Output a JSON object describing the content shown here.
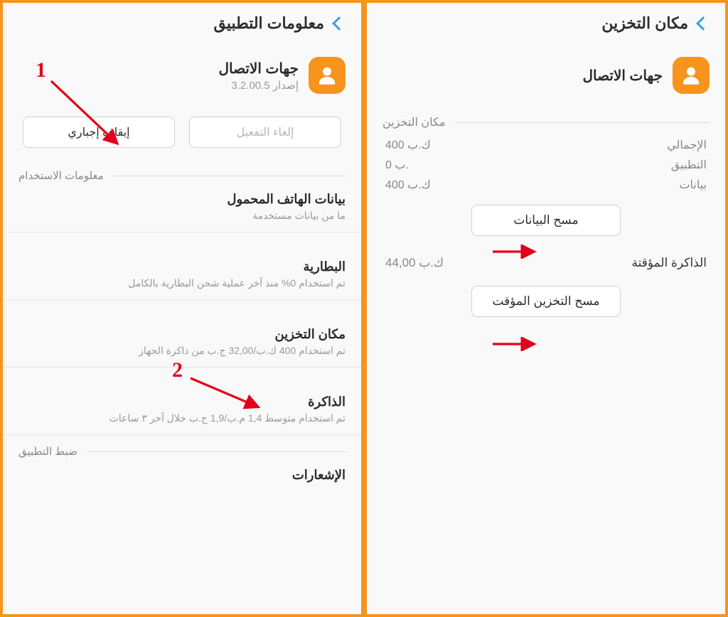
{
  "left": {
    "header_title": "معلومات التطبيق",
    "app_name": "جهات الاتصال",
    "app_version": "إصدار 3.2.00.5",
    "btn_disable": "إلغاء التفعيل",
    "btn_force_stop": "إيقاف إجباري",
    "section_usage": "معلومات الاستخدام",
    "items": {
      "mobile_data": {
        "title": "بيانات الهاتف المحمول",
        "sub": "ما من بيانات مستخدمة"
      },
      "battery": {
        "title": "البطارية",
        "sub": "تم استخدام 0% منذ آخر عملية شحن البطارية بالكامل"
      },
      "storage": {
        "title": "مكان التخزين",
        "sub": "تم استخدام 400 ك.ب/32,00 ج.ب من ذاكرة الجهاز"
      },
      "memory": {
        "title": "الذاكرة",
        "sub": "تم استخدام متوسط 1,4 م.ب/1,9 ج.ب خلال آخر ٣ ساعات"
      }
    },
    "section_appsettings": "ضبط التطبيق",
    "notifications_title": "الإشعارات",
    "callouts": {
      "num1": "1",
      "num2": "2"
    }
  },
  "right": {
    "header_title": "مكان التخزين",
    "app_name": "جهات الاتصال",
    "section_storage": "مكان التخزين",
    "rows": {
      "total": {
        "label": "الإجمالي",
        "value": "400 ك.ب"
      },
      "app": {
        "label": "التطبيق",
        "value": "0 ب."
      },
      "data": {
        "label": "بيانات",
        "value": "400 ك.ب"
      }
    },
    "btn_clear_data": "مسح البيانات",
    "cache_label": "الذاكرة المؤقتة",
    "cache_value": "44,00 ك.ب",
    "btn_clear_cache": "مسح التخزين المؤقت"
  }
}
